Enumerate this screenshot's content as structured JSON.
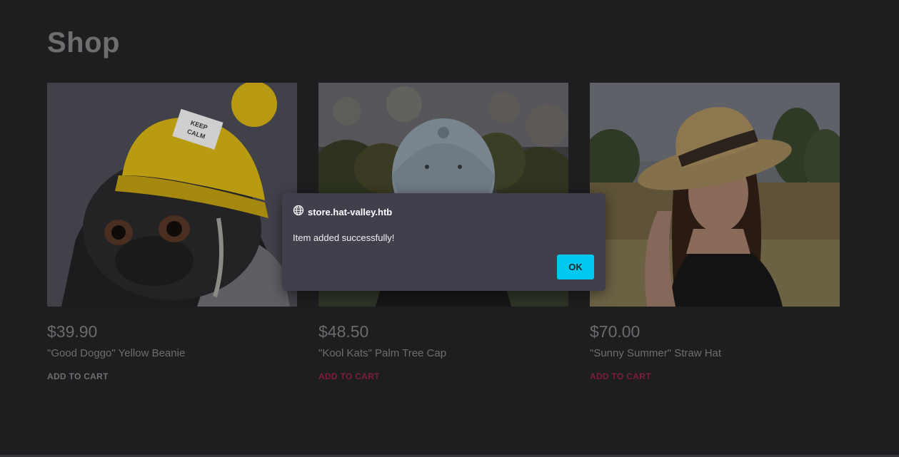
{
  "page": {
    "title": "Shop"
  },
  "products": [
    {
      "price": "$39.90",
      "name": "\"Good Doggo\" Yellow Beanie",
      "add_label": "ADD TO CART",
      "image_icon": "pug-yellow-beanie-photo",
      "beanie_patch_text": "KEEP CALM"
    },
    {
      "price": "$48.50",
      "name": "\"Kool Kats\" Palm Tree Cap",
      "add_label": "ADD TO CART",
      "image_icon": "denim-cap-photo"
    },
    {
      "price": "$70.00",
      "name": "\"Sunny Summer\" Straw Hat",
      "add_label": "ADD TO CART",
      "image_icon": "straw-hat-photo"
    }
  ],
  "dialog": {
    "origin": "store.hat-valley.htb",
    "message": "Item added successfully!",
    "ok_label": "OK",
    "icon": "globe-icon"
  },
  "colors": {
    "background": "#1e1e21",
    "dialog_bg": "#423f4c",
    "ok_button": "#00c8ee",
    "accent_link": "#7a1d3c"
  }
}
